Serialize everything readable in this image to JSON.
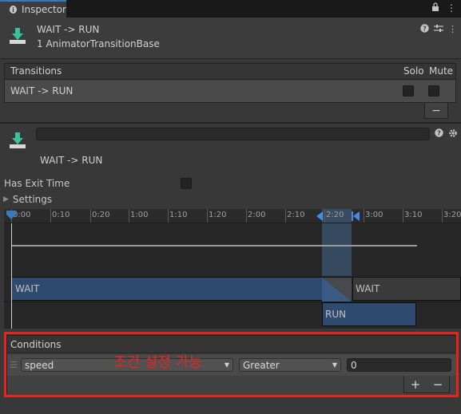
{
  "tab": {
    "title": "Inspector",
    "icon": "info-icon"
  },
  "window_icons": [
    "lock-icon",
    "menu-icon"
  ],
  "header": {
    "title": "WAIT -> RUN",
    "subtitle": "1 AnimatorTransitionBase",
    "icons": [
      "help-icon",
      "sliders-icon",
      "more-icon"
    ]
  },
  "transitions": {
    "header_label": "Transitions",
    "solo_label": "Solo",
    "mute_label": "Mute",
    "rows": [
      {
        "label": "WAIT -> RUN",
        "solo": false,
        "mute": false
      }
    ],
    "remove_label": "−"
  },
  "editor": {
    "name_value": "",
    "title": "WAIT -> RUN",
    "icons": [
      "help-icon",
      "settings-icon"
    ]
  },
  "has_exit_time": {
    "label": "Has Exit Time",
    "checked": false
  },
  "settings": {
    "label": "Settings",
    "expanded": false
  },
  "timeline": {
    "ticks": [
      "0:00",
      "0:10",
      "0:20",
      "1:00",
      "1:10",
      "1:20",
      "2:00",
      "2:10",
      "2:20",
      "3:00",
      "3:10",
      "3:20"
    ],
    "source_state": "WAIT",
    "next_state_label": "WAIT",
    "destination_state": "RUN"
  },
  "conditions": {
    "header_label": "Conditions",
    "rows": [
      {
        "parameter": "speed",
        "mode": "Greater",
        "threshold": "0"
      }
    ],
    "add_label": "+",
    "remove_label": "−"
  },
  "annotation": {
    "text": "조건 설정 가능",
    "color": "#e8231d"
  },
  "colors": {
    "accent_blue": "#3a79bb",
    "state_bar": "#2e4a6e",
    "highlight": "#e8231d"
  }
}
